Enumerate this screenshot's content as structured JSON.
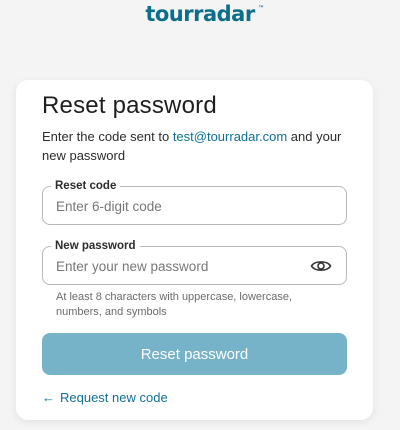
{
  "brand": {
    "logo_text": "tourradar",
    "logo_tm": "™",
    "color": "#0d6e8a"
  },
  "card": {
    "title": "Reset password",
    "subtitle_prefix": "Enter the code sent to ",
    "email": "test@tourradar.com",
    "subtitle_suffix": " and your new password"
  },
  "code_field": {
    "label": "Reset code",
    "placeholder": "Enter 6-digit code",
    "value": ""
  },
  "password_field": {
    "label": "New password",
    "placeholder": "Enter your new password",
    "value": "",
    "icon": "eye-icon",
    "hint": "At least 8 characters with uppercase, lowercase, numbers, and symbols"
  },
  "submit": {
    "label": "Reset password",
    "color": "#76b3c9"
  },
  "back_link": {
    "arrow": "←",
    "label": "Request new code",
    "color": "#0f7095"
  }
}
